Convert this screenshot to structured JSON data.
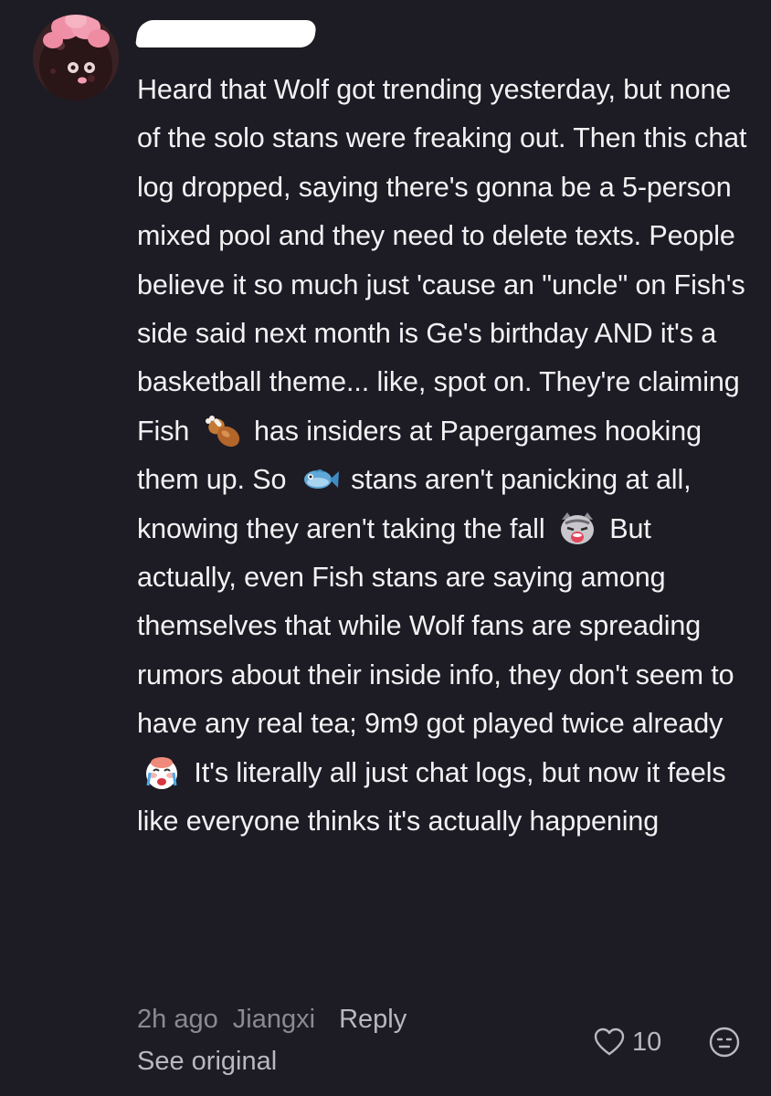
{
  "comment": {
    "avatar_icon": "pink-flower-cookie-avatar",
    "username": "",
    "body_segments": [
      "Heard that Wolf got trending yesterday, but none of the solo stans were freaking out. Then this chat log dropped, saying there's gonna be a 5-person mixed pool and they need to delete texts. People believe it so much just 'cause an \"uncle\" on Fish's side said next month is Ge's birthday AND it's a basketball theme... like, spot on. They're claiming Fish",
      "has insiders at Papergames hooking them up. So",
      "stans aren't panicking at all, knowing they aren't taking the fall",
      "But actually, even Fish stans are saying among themselves that while Wolf fans are spreading rumors about their inside info, they don't seem to have any real tea; 9m9 got played twice already",
      "It's literally all just chat logs, but now it feels like everyone thinks it's actually happening"
    ],
    "inline_emojis": [
      "drumstick-emoji",
      "fish-emoji",
      "cat-crying-emoji",
      "crying-face-emoji"
    ]
  },
  "meta": {
    "time": "2h ago",
    "location": "Jiangxi",
    "reply_label": "Reply",
    "see_original_label": "See original",
    "like_icon": "heart-outline-icon",
    "like_count": "10",
    "react_icon": "emoji-reaction-icon"
  },
  "colors": {
    "background": "#1d1c24",
    "body_text": "#f2f2f4",
    "meta_text": "#8b8a93",
    "action_text": "#b9b8c0"
  }
}
